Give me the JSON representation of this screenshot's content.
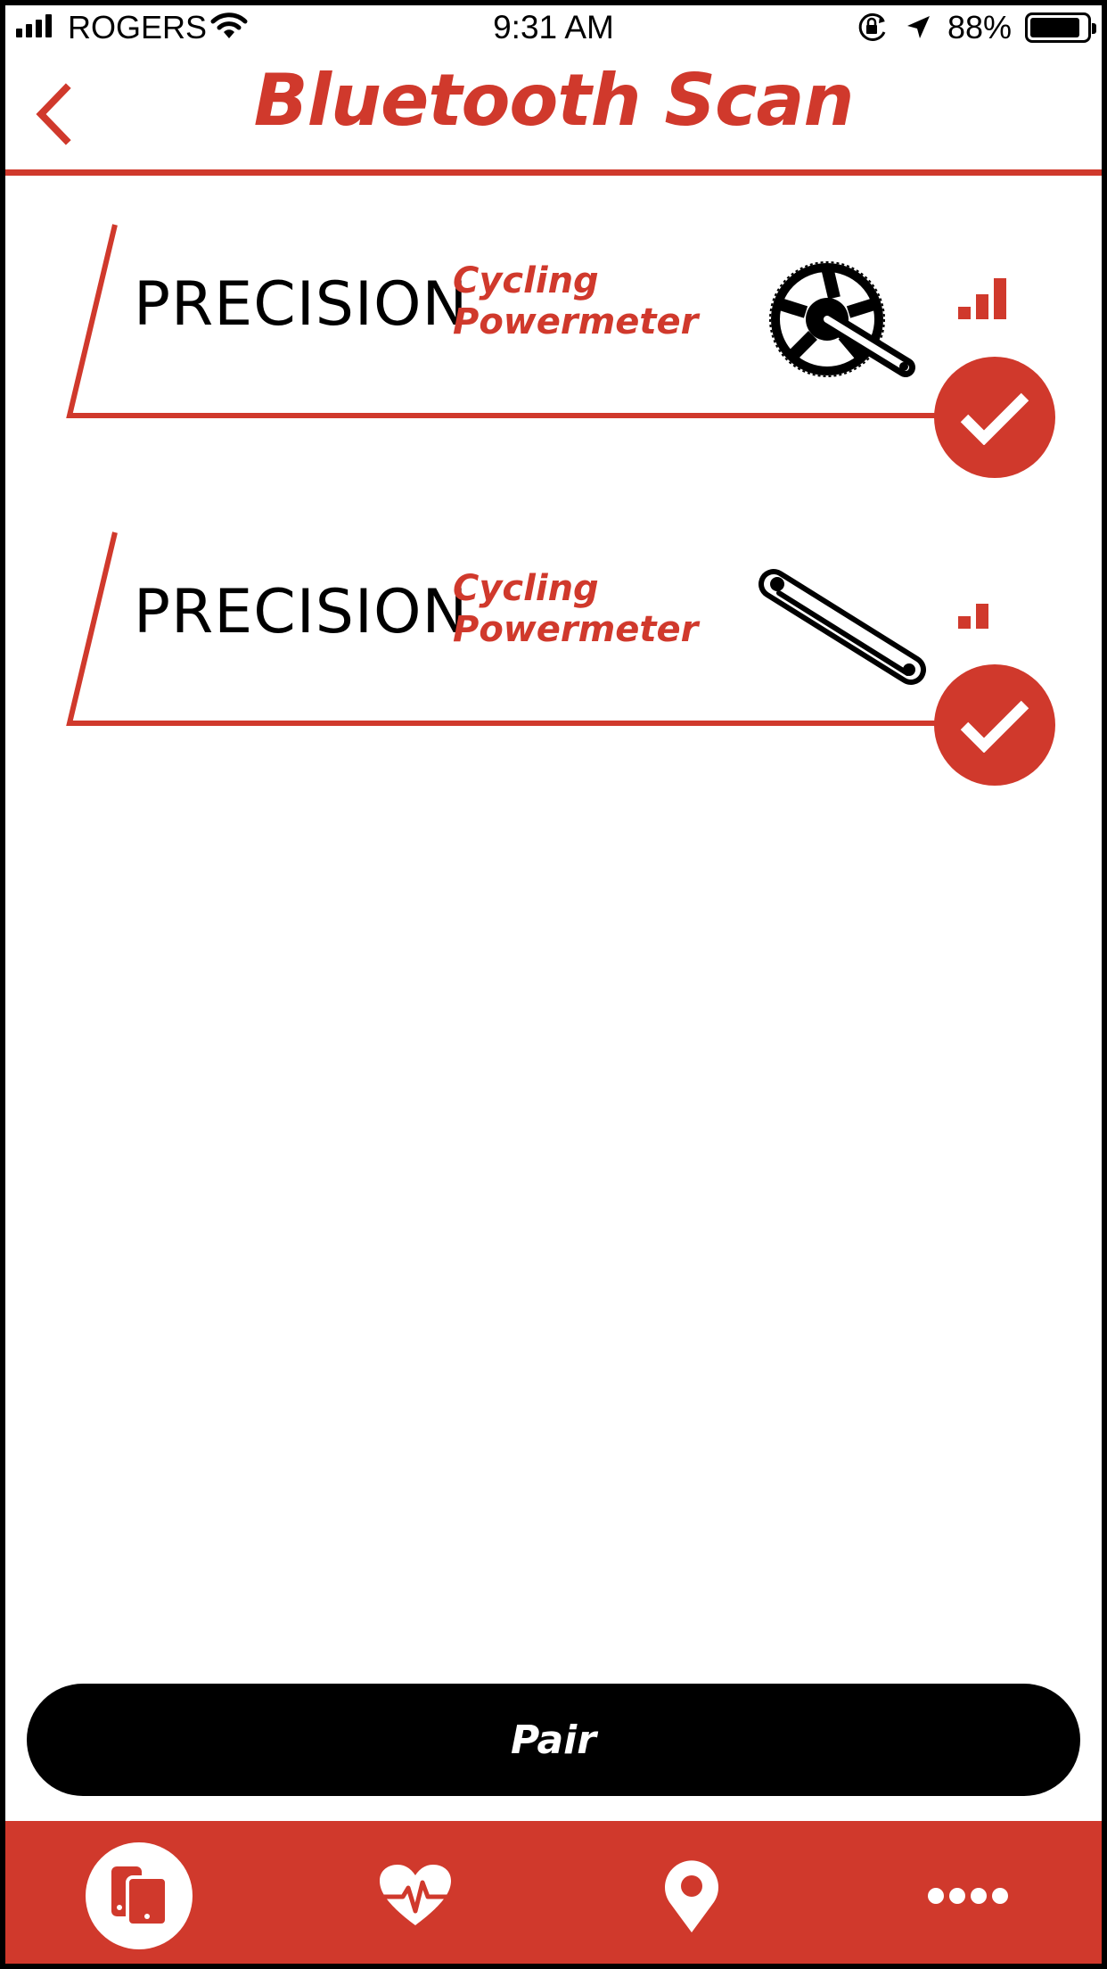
{
  "status_bar": {
    "carrier": "ROGERS",
    "time": "9:31 AM",
    "battery_percent_text": "88%",
    "battery_level": 0.88,
    "signal_bars": 4
  },
  "header": {
    "title": "Bluetooth Scan",
    "back_icon": "chevron-left-icon"
  },
  "devices": [
    {
      "brand": "PRECISION",
      "type_line1": "Cycling",
      "type_line2": "Powermeter",
      "image_icon": "crankset-icon",
      "signal_strength": 3,
      "selected": true
    },
    {
      "brand": "PRECISION",
      "type_line1": "Cycling",
      "type_line2": "Powermeter",
      "image_icon": "crank-arm-icon",
      "signal_strength": 2,
      "selected": true
    }
  ],
  "actions": {
    "pair_label": "Pair"
  },
  "tabs": [
    {
      "icon": "devices-icon",
      "active": true
    },
    {
      "icon": "heart-rate-icon",
      "active": false
    },
    {
      "icon": "location-pin-icon",
      "active": false
    },
    {
      "icon": "more-icon",
      "active": false
    }
  ],
  "colors": {
    "accent": "#d0392c",
    "text": "#000000",
    "background": "#ffffff"
  }
}
